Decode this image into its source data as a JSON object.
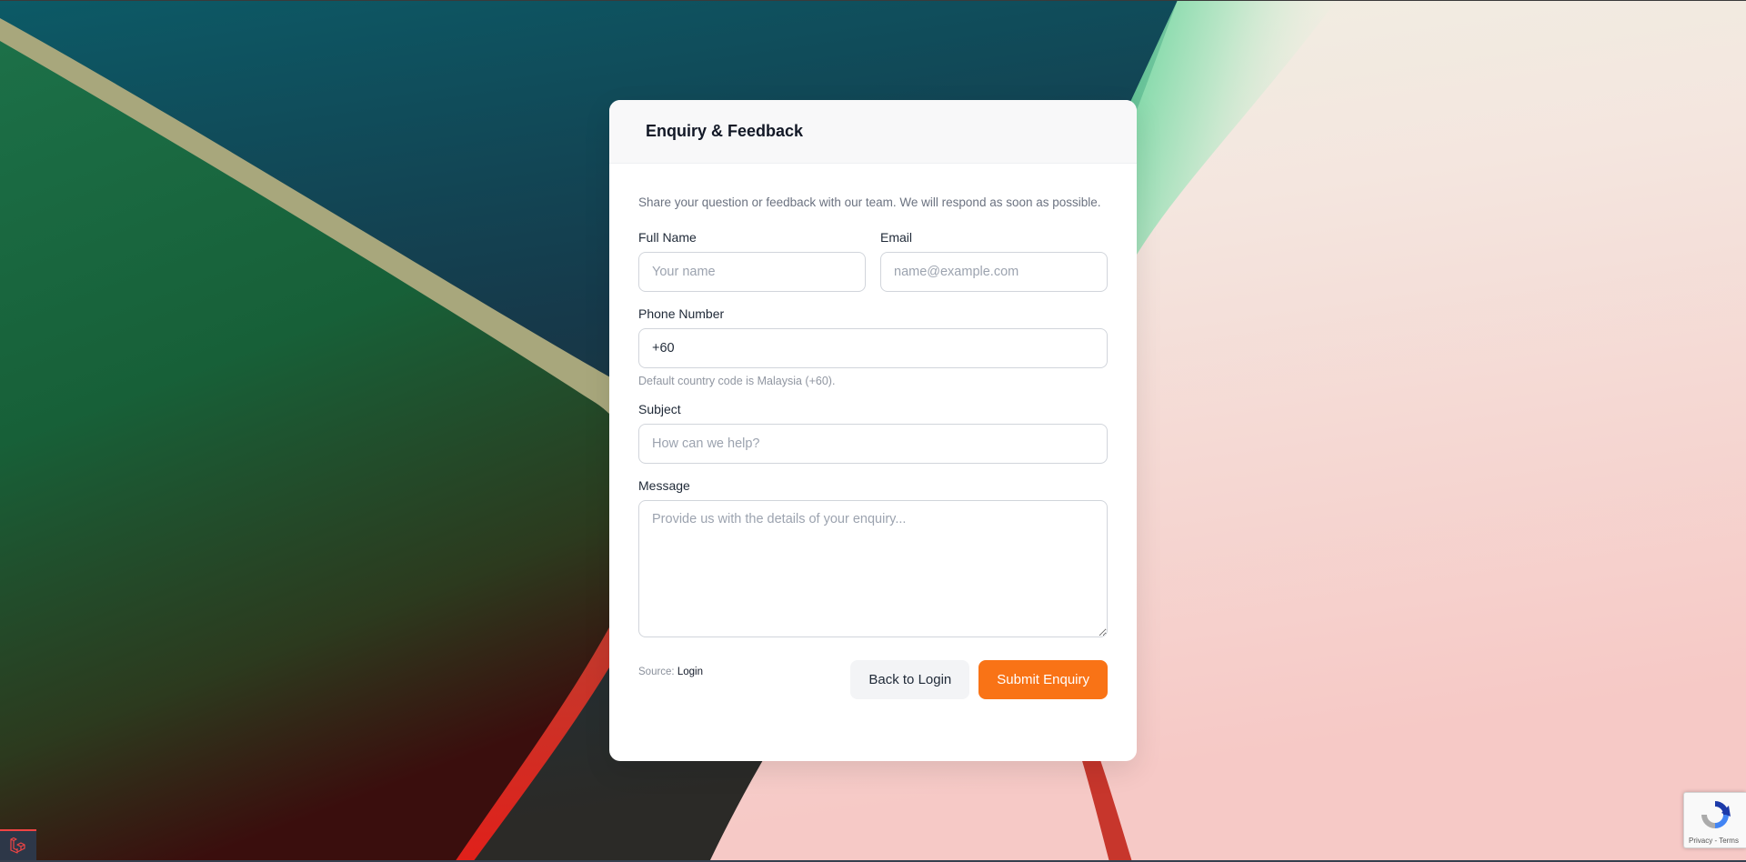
{
  "form": {
    "title": "Enquiry & Feedback",
    "intro": "Share your question or feedback with our team. We will respond as soon as possible.",
    "full_name": {
      "label": "Full Name",
      "placeholder": "Your name",
      "value": ""
    },
    "email": {
      "label": "Email",
      "placeholder": "name@example.com",
      "value": ""
    },
    "phone": {
      "label": "Phone Number",
      "value": "+60",
      "hint": "Default country code is Malaysia (+60)."
    },
    "subject": {
      "label": "Subject",
      "placeholder": "How can we help?",
      "value": ""
    },
    "message": {
      "label": "Message",
      "placeholder": "Provide us with the details of your enquiry...",
      "value": ""
    },
    "source": {
      "label": "Source:",
      "value": "Login"
    },
    "back_label": "Back to Login",
    "submit_label": "Submit Enquiry"
  },
  "recaptcha": {
    "text": "Privacy - Terms"
  },
  "colors": {
    "accent": "#f97316",
    "card_header_bg": "#f8f8f9",
    "label_text": "#1f2937",
    "muted_text": "#6b7280"
  },
  "icons": {
    "recaptcha": "recaptcha-icon",
    "debugbar": "laravel-icon"
  }
}
